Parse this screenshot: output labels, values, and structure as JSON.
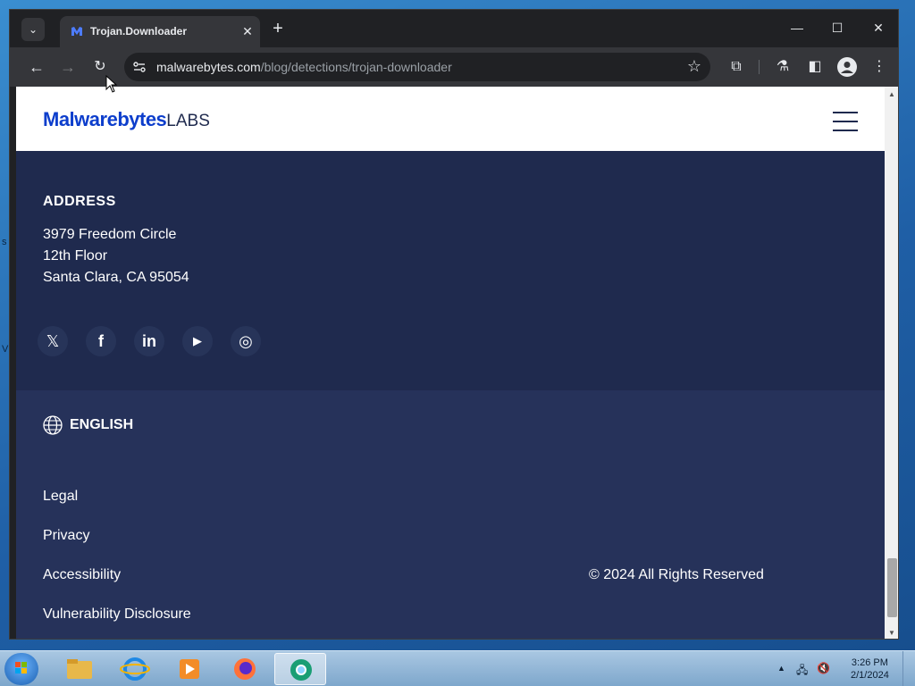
{
  "desktop": {
    "edge_text_1": "s",
    "edge_text_2": "V"
  },
  "browser": {
    "tab": {
      "title": "Trojan.Downloader"
    },
    "url": {
      "host": "malwarebytes.com",
      "path": "/blog/detections/trojan-downloader"
    }
  },
  "site": {
    "logo": {
      "brand": "Malwarebytes",
      "labs": "LABS"
    },
    "address": {
      "heading": "ADDRESS",
      "lines": [
        "3979 Freedom Circle",
        "12th Floor",
        "Santa Clara, CA 95054"
      ]
    },
    "social": [
      {
        "name": "x-icon",
        "glyph": "𝕏"
      },
      {
        "name": "facebook-icon",
        "glyph": "f"
      },
      {
        "name": "linkedin-icon",
        "glyph": "in"
      },
      {
        "name": "youtube-icon",
        "glyph": "▶"
      },
      {
        "name": "instagram-icon",
        "glyph": "◎"
      }
    ],
    "language": "ENGLISH",
    "footer_links": [
      "Legal",
      "Privacy",
      "Accessibility",
      "Vulnerability Disclosure"
    ],
    "copyright": "© 2024 All Rights Reserved"
  },
  "taskbar": {
    "time": "3:26 PM",
    "date": "2/1/2024"
  },
  "colors": {
    "accent": "#0d3ecc",
    "footer_dark": "#1f2a4e",
    "footer_light": "#26325a"
  }
}
